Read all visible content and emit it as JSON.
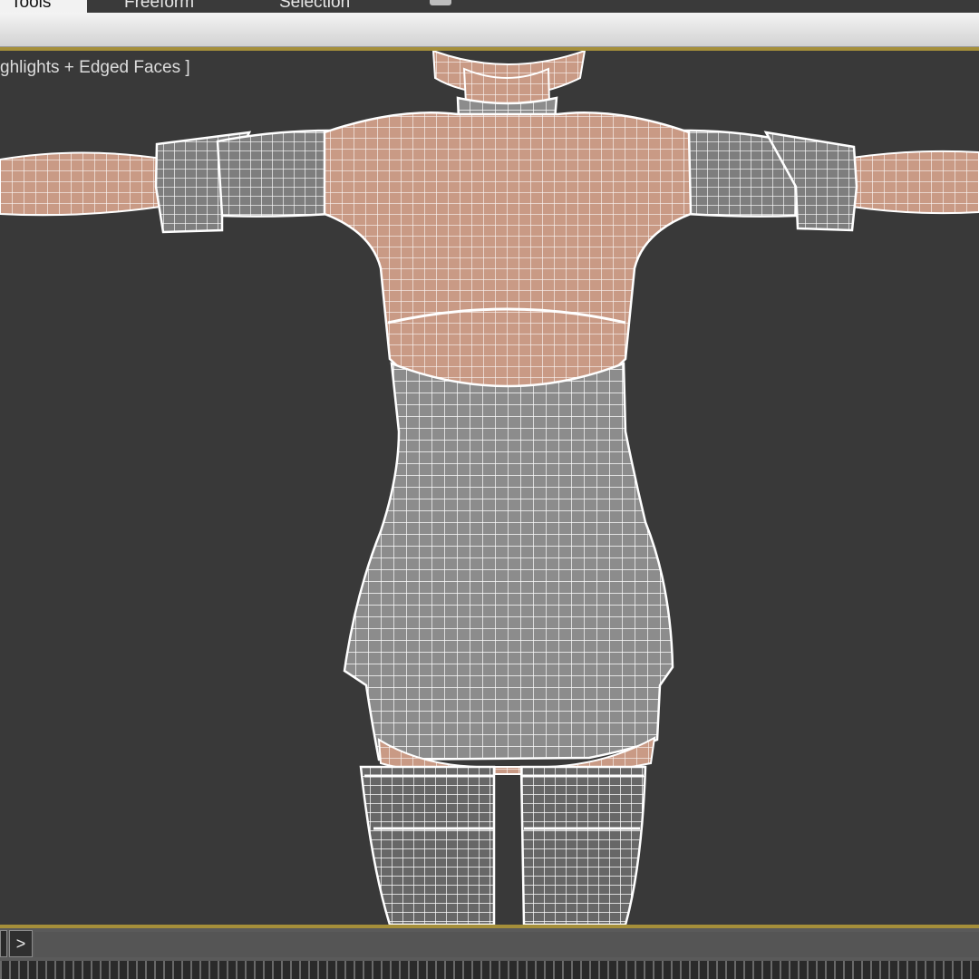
{
  "ribbon": {
    "tabs": [
      {
        "label": "Tools",
        "active": true
      },
      {
        "label": "Freeform",
        "active": false
      },
      {
        "label": "Selection",
        "active": false
      }
    ]
  },
  "viewport": {
    "shading_label": "ghlights + Edged Faces ]",
    "background": "#393939"
  },
  "timeline": {
    "next_label": ">"
  },
  "colors": {
    "accent": "#a58f3a",
    "skin": "#c99a85",
    "cloth": "#8a8a8a",
    "wire": "#ffffff"
  }
}
